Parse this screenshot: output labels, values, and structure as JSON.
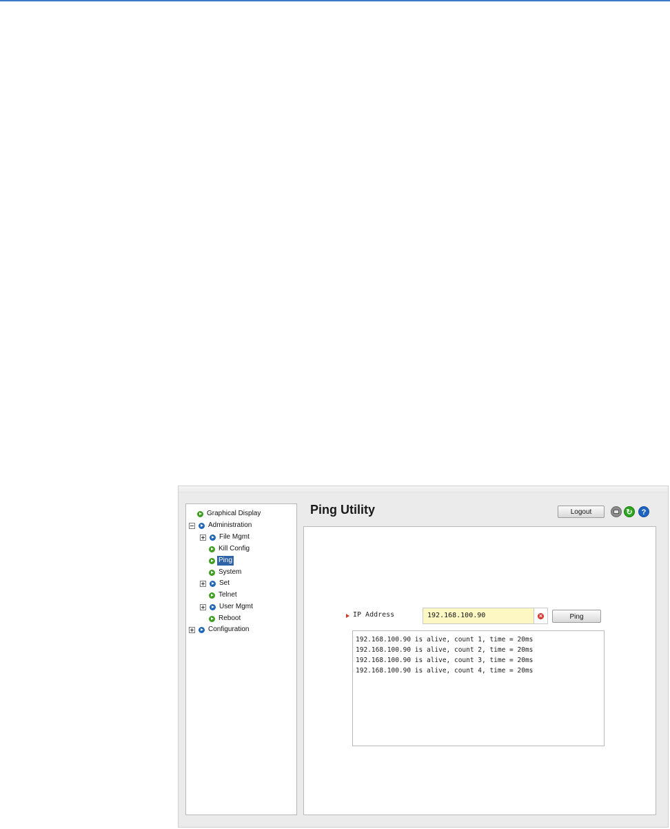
{
  "page": {
    "title": "Ping Utility"
  },
  "toolbar": {
    "logout_label": "Logout",
    "icons": [
      "print-icon",
      "refresh-icon",
      "help-icon"
    ],
    "help_glyph": "?",
    "refresh_glyph": "↻"
  },
  "nav": {
    "items": [
      {
        "label": "Graphical Display",
        "level": 0,
        "expander": "none",
        "bullet": "green"
      },
      {
        "label": "Administration",
        "level": 0,
        "expander": "minus",
        "bullet": "blue"
      },
      {
        "label": "File Mgmt",
        "level": 1,
        "expander": "plus",
        "bullet": "blue"
      },
      {
        "label": "Kill Config",
        "level": 1,
        "expander": "none",
        "bullet": "green"
      },
      {
        "label": "Ping",
        "level": 1,
        "expander": "none",
        "bullet": "green",
        "selected": true
      },
      {
        "label": "System",
        "level": 1,
        "expander": "none",
        "bullet": "green"
      },
      {
        "label": "Set",
        "level": 1,
        "expander": "plus",
        "bullet": "blue"
      },
      {
        "label": "Telnet",
        "level": 1,
        "expander": "none",
        "bullet": "green"
      },
      {
        "label": "User Mgmt",
        "level": 1,
        "expander": "plus",
        "bullet": "blue"
      },
      {
        "label": "Reboot",
        "level": 1,
        "expander": "none",
        "bullet": "green"
      },
      {
        "label": "Configuration",
        "level": 0,
        "expander": "plus",
        "bullet": "blue"
      }
    ]
  },
  "form": {
    "ip_label": "IP Address",
    "ip_value": "192.168.100.90",
    "ping_button": "Ping"
  },
  "output": {
    "lines": [
      "192.168.100.90 is alive, count 1, time = 20ms",
      "192.168.100.90 is alive, count 2, time = 20ms",
      "192.168.100.90 is alive, count 3, time = 20ms",
      "192.168.100.90 is alive, count 4, time = 20ms"
    ]
  },
  "colors": {
    "accent_rule": "#3a7ac8",
    "bullet_green": "#3f9e1f",
    "bullet_blue": "#1f65b8",
    "selection": "#2f63a8",
    "input_bg": "#fdf7c3"
  }
}
